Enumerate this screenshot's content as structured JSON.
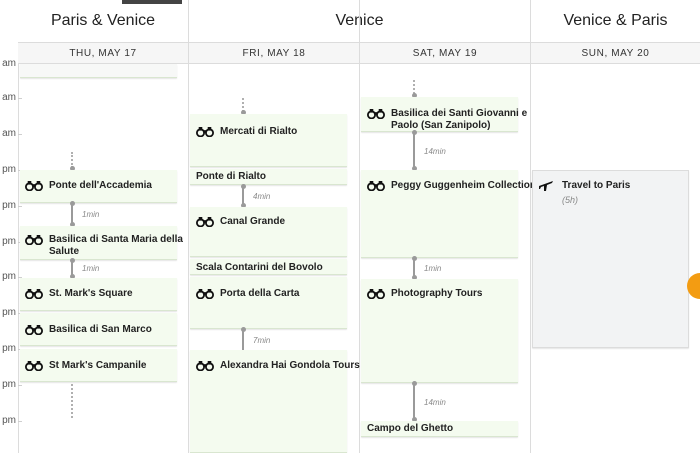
{
  "groups": [
    {
      "label": "Paris & Venice"
    },
    {
      "label": "Venice"
    },
    {
      "label": "Venice & Paris"
    }
  ],
  "days": [
    {
      "label": "THU, MAY 17"
    },
    {
      "label": "FRI, MAY 18"
    },
    {
      "label": "SAT, MAY 19"
    },
    {
      "label": "SUN, MAY 20"
    }
  ],
  "time_labels": [
    "am",
    "am",
    "am",
    "pm",
    "pm",
    "pm",
    "pm",
    "pm",
    "pm",
    "pm",
    "pm"
  ],
  "thu": {
    "ponte": "Ponte dell'Accademia",
    "t1": "1min",
    "basilica_salute_1": "Basilica di Santa Maria della",
    "basilica_salute_2": "Salute",
    "t2": "1min",
    "stmarks_square": "St. Mark's Square",
    "san_marco": "Basilica di San Marco",
    "campanile": "St Mark's Campanile"
  },
  "fri": {
    "mercati": "Mercati di Rialto",
    "ponte_rialto": "Ponte di Rialto",
    "t1": "4min",
    "canal": "Canal Grande",
    "scala": "Scala Contarini del Bovolo",
    "porta": "Porta della Carta",
    "t2": "7min",
    "gondola": "Alexandra Hai Gondola Tours"
  },
  "sat": {
    "basilica_1": "Basilica dei Santi Giovanni e",
    "basilica_2": "Paolo (San Zanipolo)",
    "t1": "14min",
    "peggy": "Peggy Guggenheim Collection",
    "t2": "1min",
    "photo": "Photography Tours",
    "t3": "14min",
    "ghetto": "Campo del Ghetto"
  },
  "sun": {
    "travel": "Travel to Paris",
    "duration": "(5h)"
  },
  "icons": {
    "activity": "binoculars-icon",
    "travel": "airplane-icon",
    "fab": "orange-circle-button"
  },
  "colors": {
    "card_bg": "#f4fbef",
    "travel_card_bg": "#f2f3f4",
    "fab": "#f39c12"
  }
}
